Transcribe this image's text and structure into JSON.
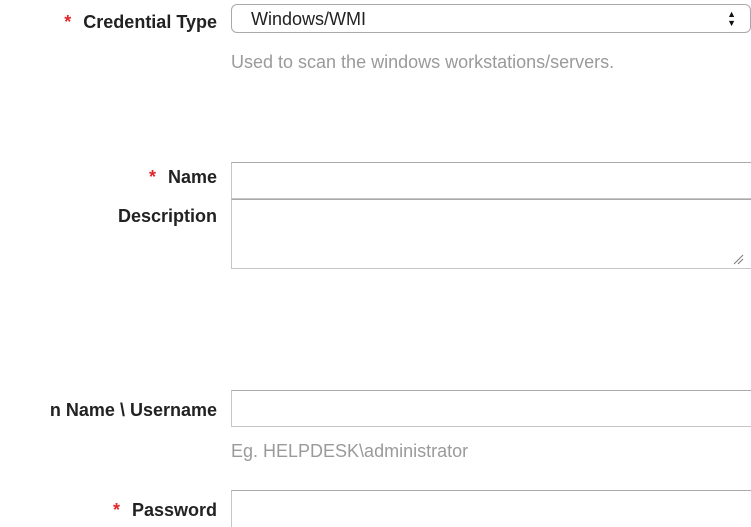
{
  "form": {
    "credential_type": {
      "required_marker": "*",
      "label": "Credential Type",
      "value": "Windows/WMI",
      "help": "Used to scan the windows workstations/servers."
    },
    "name": {
      "required_marker": "*",
      "label": "Name",
      "value": ""
    },
    "description": {
      "label": "Description",
      "value": ""
    },
    "username": {
      "label": "n Name \\ Username",
      "value": "",
      "help": "Eg. HELPDESK\\administrator"
    },
    "password": {
      "required_marker": "*",
      "label": "Password",
      "value": ""
    }
  },
  "icons": {
    "select_arrows": "updown-chevron-icon",
    "resize_handle": "resize-handle-icon"
  },
  "colors": {
    "required": "#e0262a",
    "help_text": "#9a9a9a",
    "label_text": "#222222",
    "border": "#a9a9a9"
  }
}
